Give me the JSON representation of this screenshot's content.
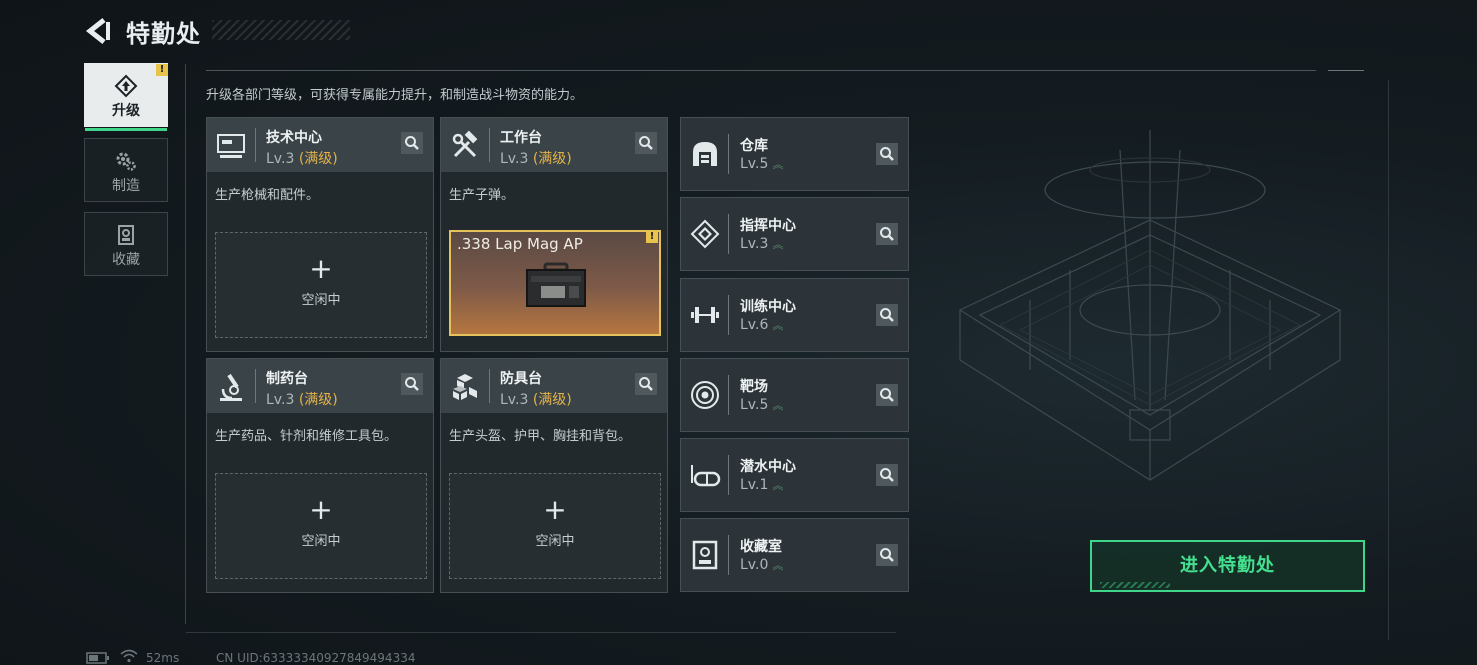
{
  "header": {
    "title": "特勤处"
  },
  "tabs": [
    {
      "label": "升级",
      "icon": "upgrade-icon",
      "active": true,
      "warning": "!"
    },
    {
      "label": "制造",
      "icon": "gears-icon",
      "active": false
    },
    {
      "label": "收藏",
      "icon": "collection-icon",
      "active": false
    }
  ],
  "description": "升级各部门等级，可获得专属能力提升，和制造战斗物资的能力。",
  "facilities": [
    {
      "name": "技术中心",
      "level": "Lv.3",
      "max": "(满级)",
      "desc": "生产枪械和配件。",
      "slot_label": "空闲中",
      "plus": "+",
      "icon": "computer-icon"
    },
    {
      "name": "工作台",
      "level": "Lv.3",
      "max": "(满级)",
      "desc": "生产子弹。",
      "item_name": ".338 Lap Mag AP",
      "item_warning": "!",
      "icon": "hammer-wrench-icon"
    },
    {
      "name": "制药台",
      "level": "Lv.3",
      "max": "(满级)",
      "desc": "生产药品、针剂和维修工具包。",
      "slot_label": "空闲中",
      "plus": "+",
      "icon": "microscope-icon"
    },
    {
      "name": "防具台",
      "level": "Lv.3",
      "max": "(满级)",
      "desc": "生产头盔、护甲、胸挂和背包。",
      "slot_label": "空闲中",
      "plus": "+",
      "icon": "armor-boxes-icon"
    }
  ],
  "departments": [
    {
      "name": "仓库",
      "level": "Lv.5",
      "icon": "warehouse-icon"
    },
    {
      "name": "指挥中心",
      "level": "Lv.3",
      "icon": "chip-icon"
    },
    {
      "name": "训练中心",
      "level": "Lv.6",
      "icon": "dumbbell-icon"
    },
    {
      "name": "靶场",
      "level": "Lv.5",
      "icon": "target-icon"
    },
    {
      "name": "潜水中心",
      "level": "Lv.1",
      "icon": "diving-mask-icon"
    },
    {
      "name": "收藏室",
      "level": "Lv.0",
      "icon": "collection-room-icon"
    }
  ],
  "enter_button": "进入特勤处",
  "status_bar": {
    "ping": "52ms",
    "uid": "CN UID:63333340927849494334"
  },
  "colors": {
    "accent_green": "#3fd68a",
    "max_level": "#e3b24a",
    "warning": "#e8c44a"
  }
}
